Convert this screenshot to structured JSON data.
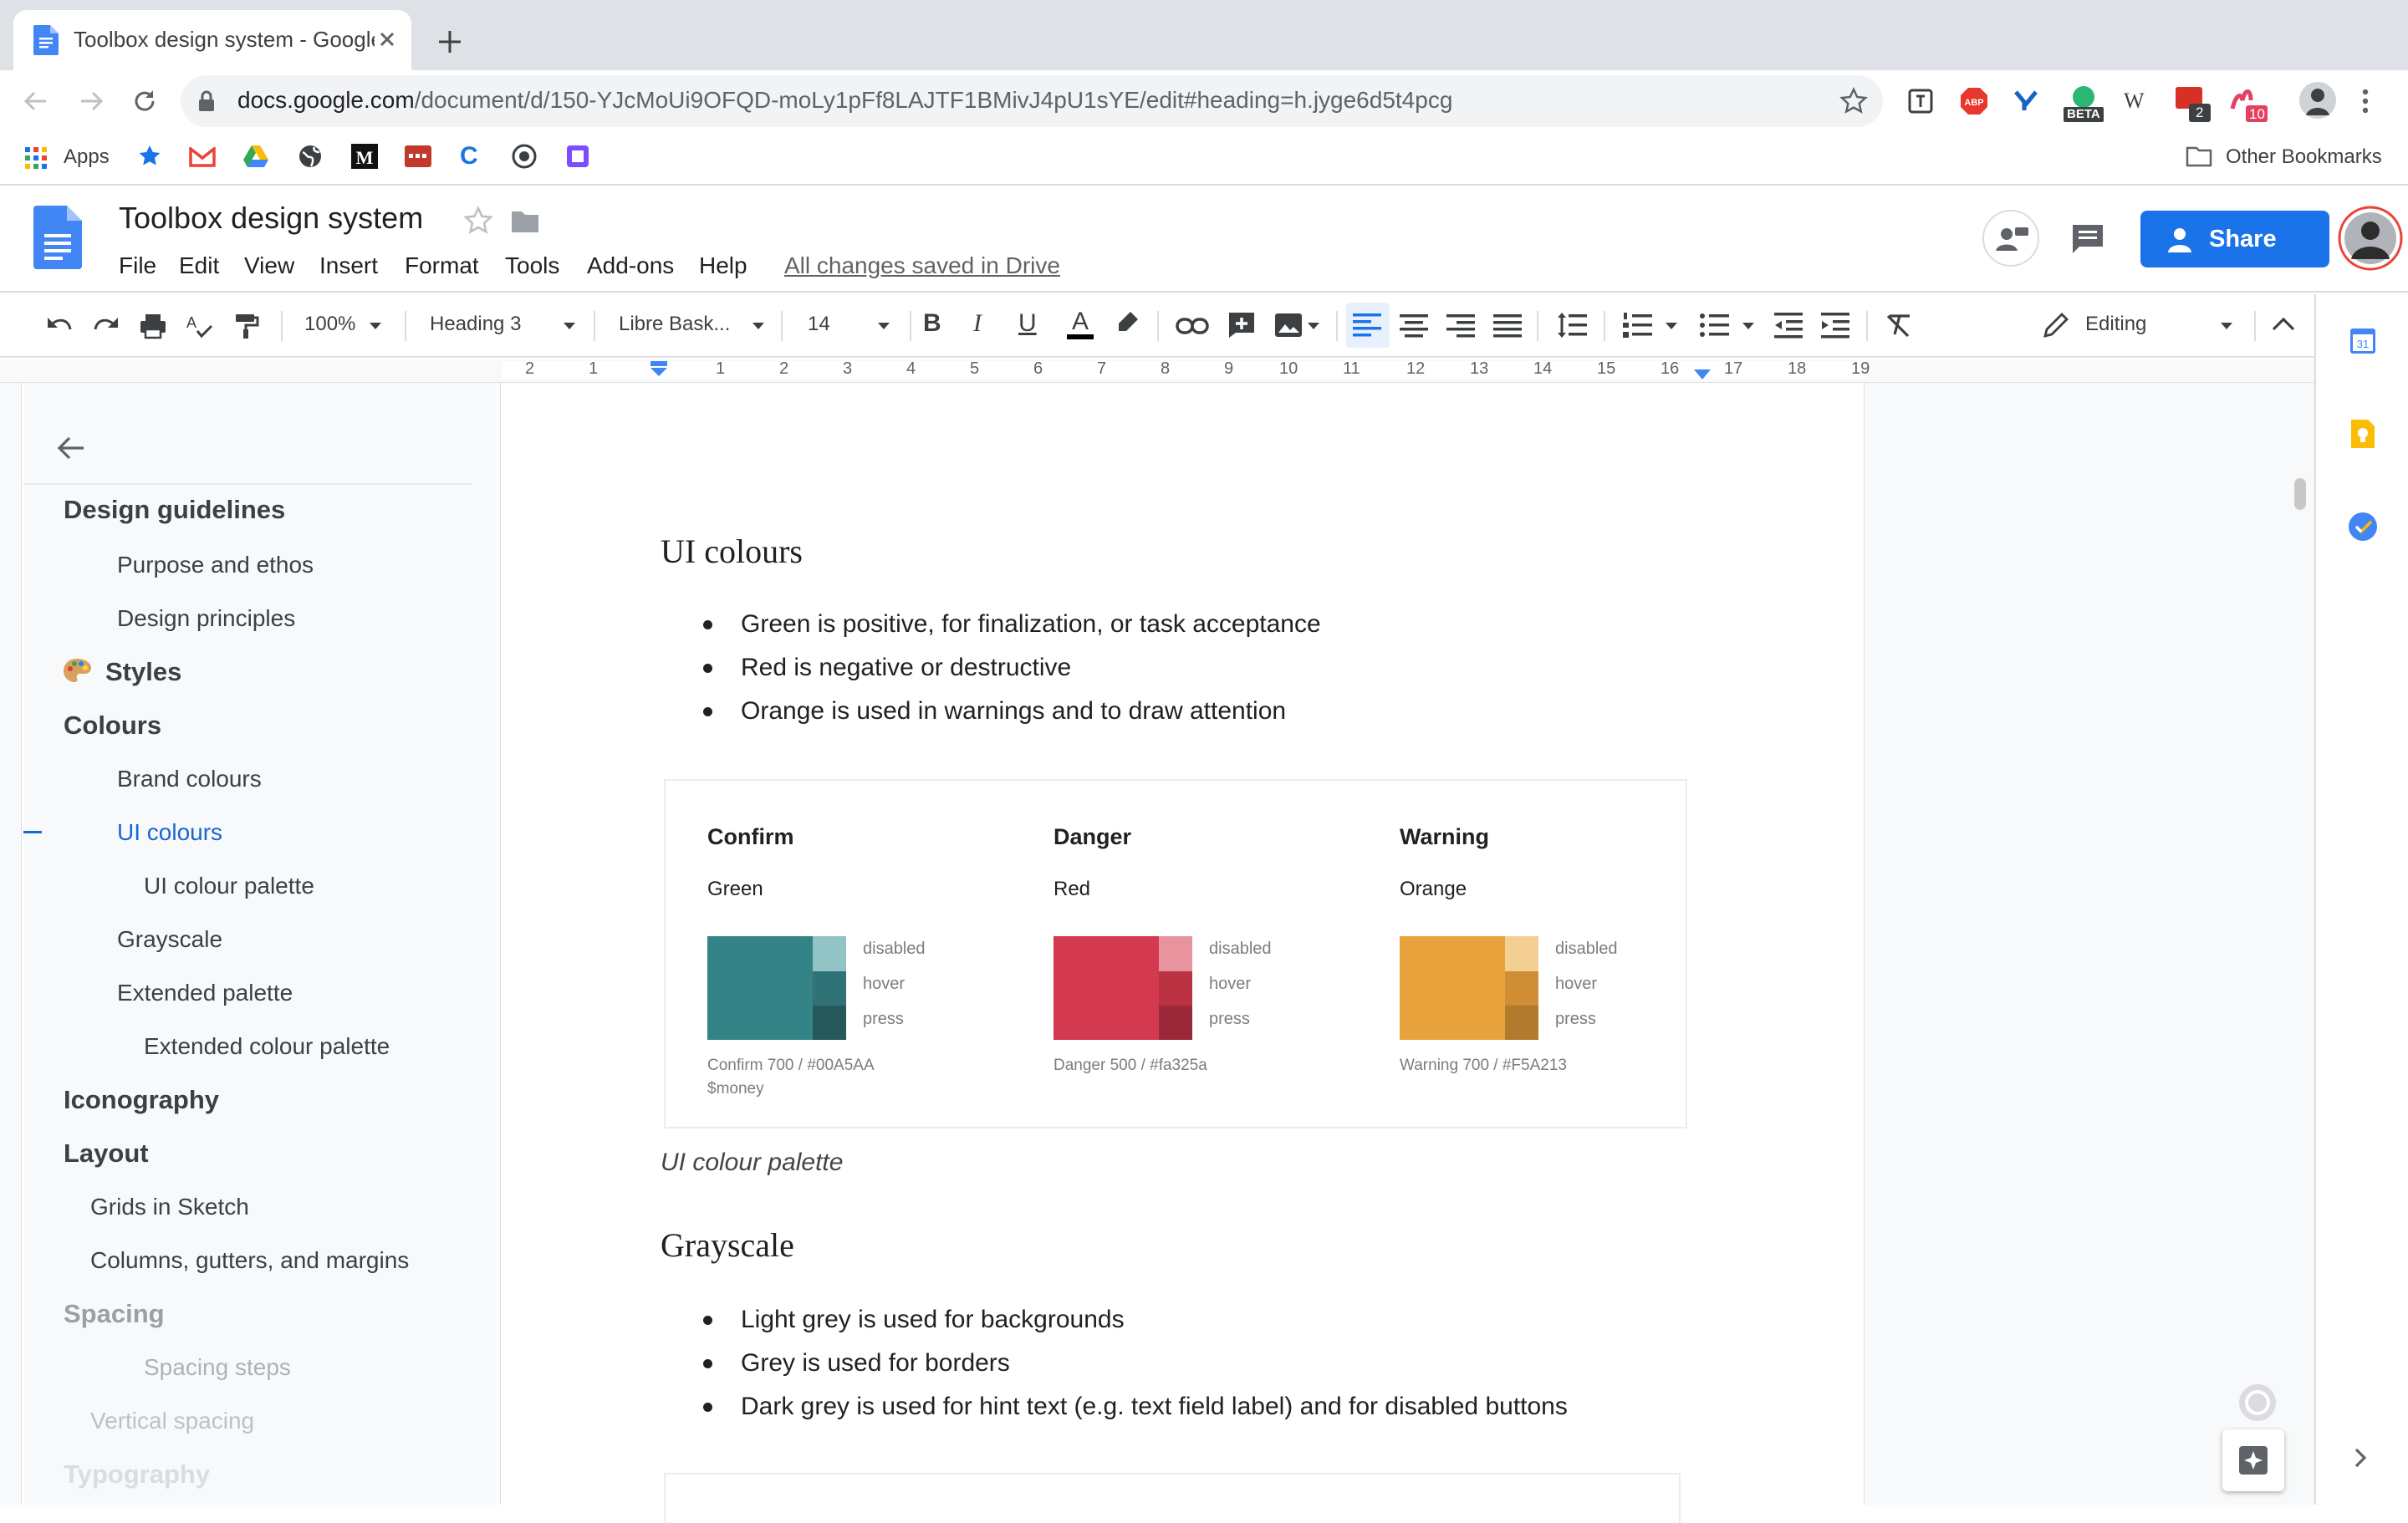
{
  "browser": {
    "tab_title": "Toolbox design system - Google Docs",
    "url_domain": "docs.google.com",
    "url_path": "/document/d/150-YJcMoUi9OFQD-moLy1pFf8LAJTF1BMivJ4pU1sYE/edit#heading=h.jyge6d5t4pcg",
    "extension_badges": {
      "beta": "BETA",
      "ext_count_a": "2",
      "ext_count_b": "10"
    },
    "bookmarks": {
      "apps": "Apps",
      "other": "Other Bookmarks"
    }
  },
  "docs": {
    "title": "Toolbox design system",
    "menu": [
      "File",
      "Edit",
      "View",
      "Insert",
      "Format",
      "Tools",
      "Add-ons",
      "Help"
    ],
    "save_status": "All changes saved in Drive",
    "share_label": "Share"
  },
  "toolbar": {
    "zoom": "100%",
    "style": "Heading 3",
    "font": "Libre Bask...",
    "font_size": "14",
    "mode": "Editing"
  },
  "ruler": [
    "2",
    "1",
    "1",
    "2",
    "3",
    "4",
    "5",
    "6",
    "7",
    "8",
    "9",
    "10",
    "11",
    "12",
    "13",
    "14",
    "15",
    "16",
    "17",
    "18",
    "19"
  ],
  "outline": [
    {
      "label": "Design guidelines",
      "level": "h1"
    },
    {
      "label": "Purpose and ethos",
      "level": "h2"
    },
    {
      "label": "Design principles",
      "level": "h2"
    },
    {
      "label": "Styles",
      "level": "h1"
    },
    {
      "label": "Colours",
      "level": "h1"
    },
    {
      "label": "Brand colours",
      "level": "h2"
    },
    {
      "label": "UI colours",
      "level": "h2"
    },
    {
      "label": "UI colour palette",
      "level": "h3"
    },
    {
      "label": "Grayscale",
      "level": "h2"
    },
    {
      "label": "Extended palette",
      "level": "h2"
    },
    {
      "label": "Extended colour palette",
      "level": "h3"
    },
    {
      "label": "Iconography",
      "level": "h1"
    },
    {
      "label": "Layout",
      "level": "h1"
    },
    {
      "label": "Grids in Sketch",
      "level": "h2"
    },
    {
      "label": "Columns, gutters, and margins",
      "level": "h2"
    },
    {
      "label": "Spacing",
      "level": "h1"
    },
    {
      "label": "Spacing steps",
      "level": "h3"
    },
    {
      "label": "Vertical spacing",
      "level": "h2"
    },
    {
      "label": "Typography",
      "level": "h1"
    }
  ],
  "document": {
    "heading_ui_colours": "UI colours",
    "ui_bullets": [
      "Green is positive, for finalization, or task acceptance",
      "Red is negative or destructive",
      "Orange is used in warnings and to draw attention"
    ],
    "palette": [
      {
        "title": "Confirm",
        "colour_name": "Green",
        "states": [
          "disabled",
          "hover",
          "press"
        ],
        "caption": "Confirm 700 / #00A5AA",
        "caption2": "$money",
        "main": "#348487",
        "shades": [
          "#93c4c5",
          "#2f7376",
          "#26595b"
        ]
      },
      {
        "title": "Danger",
        "colour_name": "Red",
        "states": [
          "disabled",
          "hover",
          "press"
        ],
        "caption": "Danger 500 / #fa325a",
        "caption2": "",
        "main": "#d33a4f",
        "shades": [
          "#e8949f",
          "#bb3243",
          "#9b2838"
        ]
      },
      {
        "title": "Warning",
        "colour_name": "Orange",
        "states": [
          "disabled",
          "hover",
          "press"
        ],
        "caption": "Warning 700 / #F5A213",
        "caption2": "",
        "main": "#e9a33c",
        "shades": [
          "#f3cf93",
          "#cf8e33",
          "#b17a2c"
        ]
      }
    ],
    "palette_caption": "UI colour palette",
    "heading_grayscale": "Grayscale",
    "grayscale_bullets": [
      "Light grey is used for backgrounds",
      "Grey is used for borders",
      "Dark grey is used for hint text (e.g. text field label) and for disabled buttons"
    ]
  },
  "colors": {
    "accent": "#1a73e8",
    "active_outline": "#1967d2"
  }
}
